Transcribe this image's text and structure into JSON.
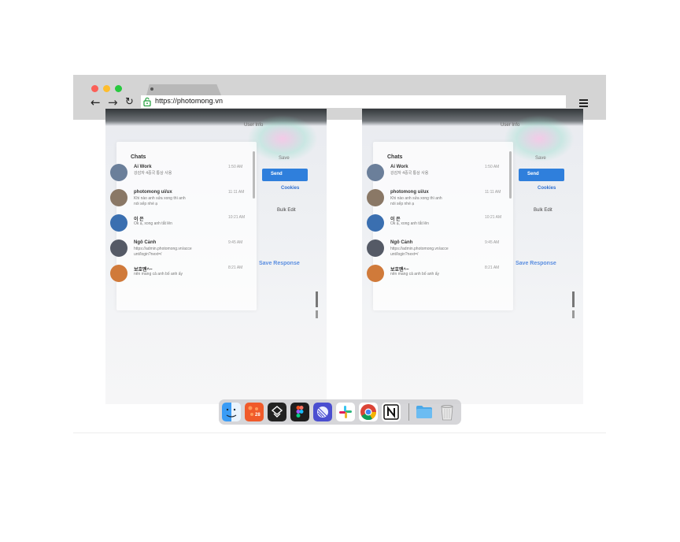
{
  "browser": {
    "url": "https://photomong.vn",
    "nav": {
      "back": "←",
      "forward": "→",
      "reload": "↻"
    }
  },
  "screenshot": {
    "header_title": "User Info",
    "chats_label": "Chats",
    "send_label": "Send",
    "save_label": "Save",
    "cookies_label": "Cookies",
    "bulk_edit_label": "Bulk Edit",
    "save_response_label": "Save Response",
    "conversations": [
      {
        "name": "Ai Work",
        "preview": "강감자 4중국 통상 사용",
        "time": "1:50 AM",
        "color": "#6b7f9a"
      },
      {
        "name": "photomong ui/ux",
        "preview": "Khi nào anh sửa xong thì anh\nnói sếp nhé ạ",
        "time": "11:11 AM",
        "color": "#8a7866"
      },
      {
        "name": "이 은",
        "preview": "Ok ạ, xong anh tắt lên",
        "time": "10:21 AM",
        "color": "#3a6fb0"
      },
      {
        "name": "Ngô Cảnh",
        "preview": "https://admin.photomong.vn/acce\nunt/login?next=/",
        "time": "9:45 AM",
        "color": "#555a66"
      },
      {
        "name": "보호맨^~",
        "preview": "nên mang cả anh bố anh ấy",
        "time": "8:21 AM",
        "color": "#d07a3a"
      }
    ]
  },
  "dock": {
    "apps": [
      {
        "name": "finder-icon",
        "color": "#3b9cf5"
      },
      {
        "name": "calendar-icon",
        "color": "#f05a2a"
      },
      {
        "name": "sketch-icon",
        "color": "#2b2b2b"
      },
      {
        "name": "figma-icon",
        "color": "#1e1e1e"
      },
      {
        "name": "linear-icon",
        "color": "#4b4fd0"
      },
      {
        "name": "slack-icon",
        "color": "#ffffff"
      },
      {
        "name": "chrome-icon",
        "color": "#ffffff"
      },
      {
        "name": "notion-icon",
        "color": "#ffffff"
      },
      {
        "name": "folder-icon",
        "color": "#4aa8e8"
      },
      {
        "name": "trash-icon",
        "color": "#e8e8e8"
      }
    ],
    "calendar_day": "28"
  },
  "colors": {
    "titlebar": "#d4d4d4",
    "traffic_red": "#fb5f57",
    "traffic_yellow": "#fdbd2e",
    "traffic_green": "#28c93f",
    "send_button": "#2f7fdc"
  }
}
